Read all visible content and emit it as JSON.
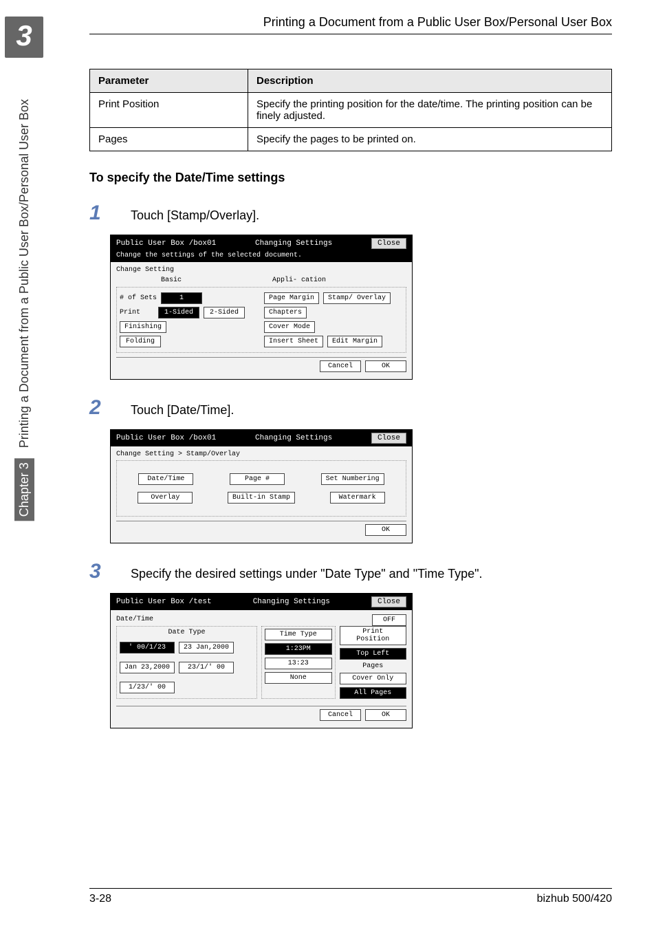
{
  "chapter_number": "3",
  "side_label": "Printing a Document from a Public User Box/Personal User Box",
  "side_chapter": "Chapter 3",
  "header_title": "Printing a Document from a Public User Box/Personal User Box",
  "table": {
    "h1": "Parameter",
    "h2": "Description",
    "r1c1": "Print Position",
    "r1c2": "Specify the printing position for the date/time. The printing position can be finely adjusted.",
    "r2c1": "Pages",
    "r2c2": "Specify the pages to be printed on."
  },
  "section_title": "To specify the Date/Time settings",
  "steps": {
    "s1n": "1",
    "s1t": "Touch [Stamp/Overlay].",
    "s2n": "2",
    "s2t": "Touch [Date/Time].",
    "s3n": "3",
    "s3t": "Specify the desired settings under \"Date Type\" and \"Time Type\"."
  },
  "scr1": {
    "title_a": "Public User Box  /box01",
    "title_b": "Changing Settings",
    "close": "Close",
    "msg": "Change the settings of the selected document.",
    "change_setting": "Change Setting",
    "basic": "Basic",
    "appli": "Appli- cation",
    "sets": "# of Sets",
    "sets_val": "1",
    "page_margin": "Page Margin",
    "stamp": "Stamp/ Overlay",
    "print": "Print",
    "sided1": "1-Sided",
    "sided2": "2-Sided",
    "chapters": "Chapters",
    "finishing": "Finishing",
    "cover": "Cover Mode",
    "folding": "Folding",
    "insert": "Insert Sheet",
    "edit": "Edit Margin",
    "cancel": "Cancel",
    "ok": "OK"
  },
  "scr2": {
    "title_a": "Public User Box  /box01",
    "title_b": "Changing Settings",
    "close": "Close",
    "path": "Change Setting > Stamp/Overlay",
    "date": "Date/Time",
    "page": "Page #",
    "setnum": "Set Numbering",
    "overlay": "Overlay",
    "builtin": "Built-in Stamp",
    "watermark": "Watermark",
    "ok": "OK"
  },
  "scr3": {
    "title_a": "Public User Box  /test",
    "title_b": "Changing Settings",
    "close": "Close",
    "heading": "Date/Time",
    "off": "OFF",
    "datetype": "Date Type",
    "timetype": "Time Type",
    "printpos": "Print Position",
    "topleft": "Top Left",
    "d1": "' 00/1/23",
    "d2": "23 Jan,2000",
    "t1": "1:23PM",
    "d3": "Jan 23,2000",
    "d4": "23/1/' 00",
    "t2": "13:23",
    "d5": "1/23/' 00",
    "t3": "None",
    "pages": "Pages",
    "cover": "Cover Only",
    "allpages": "All Pages",
    "cancel": "Cancel",
    "ok": "OK"
  },
  "footer_left": "3-28",
  "footer_right": "bizhub 500/420"
}
